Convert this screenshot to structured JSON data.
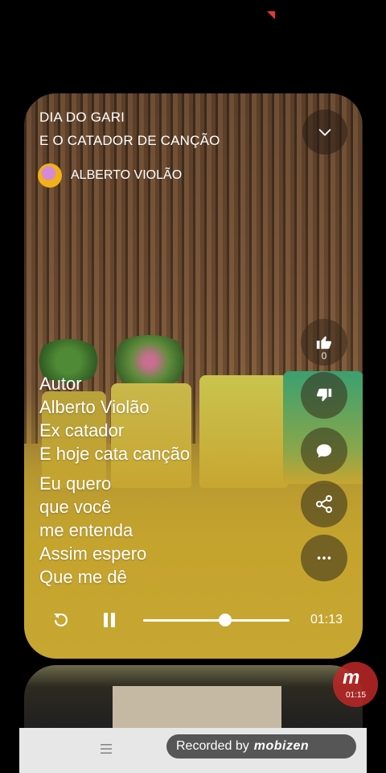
{
  "song": {
    "title_line1": "DIA DO GARI",
    "title_line2": "E O CATADOR DE CANÇÃO",
    "artist": "ALBERTO VIOLÃO"
  },
  "actions": {
    "like_count": "0",
    "icons": [
      "chevron-down-icon",
      "thumbs-up-icon",
      "thumbs-down-icon",
      "comment-icon",
      "share-icon",
      "more-icon"
    ]
  },
  "lyrics": {
    "block1": [
      "Autor",
      "Alberto Violão",
      "Ex catador",
      "E hoje cata canção"
    ],
    "block2": [
      "Eu quero",
      "que você",
      "me entenda",
      "Assim espero",
      "Que me dê"
    ]
  },
  "player": {
    "current_time": "01:13",
    "progress": 0.56
  },
  "recorder": {
    "label": "Recorded by",
    "brand": "mobizen",
    "badge_letter": "m",
    "badge_time": "01:15"
  },
  "colors": {
    "accent_yellow": "#c7a631",
    "record_red": "#be2828",
    "status_red": "#e53935"
  }
}
